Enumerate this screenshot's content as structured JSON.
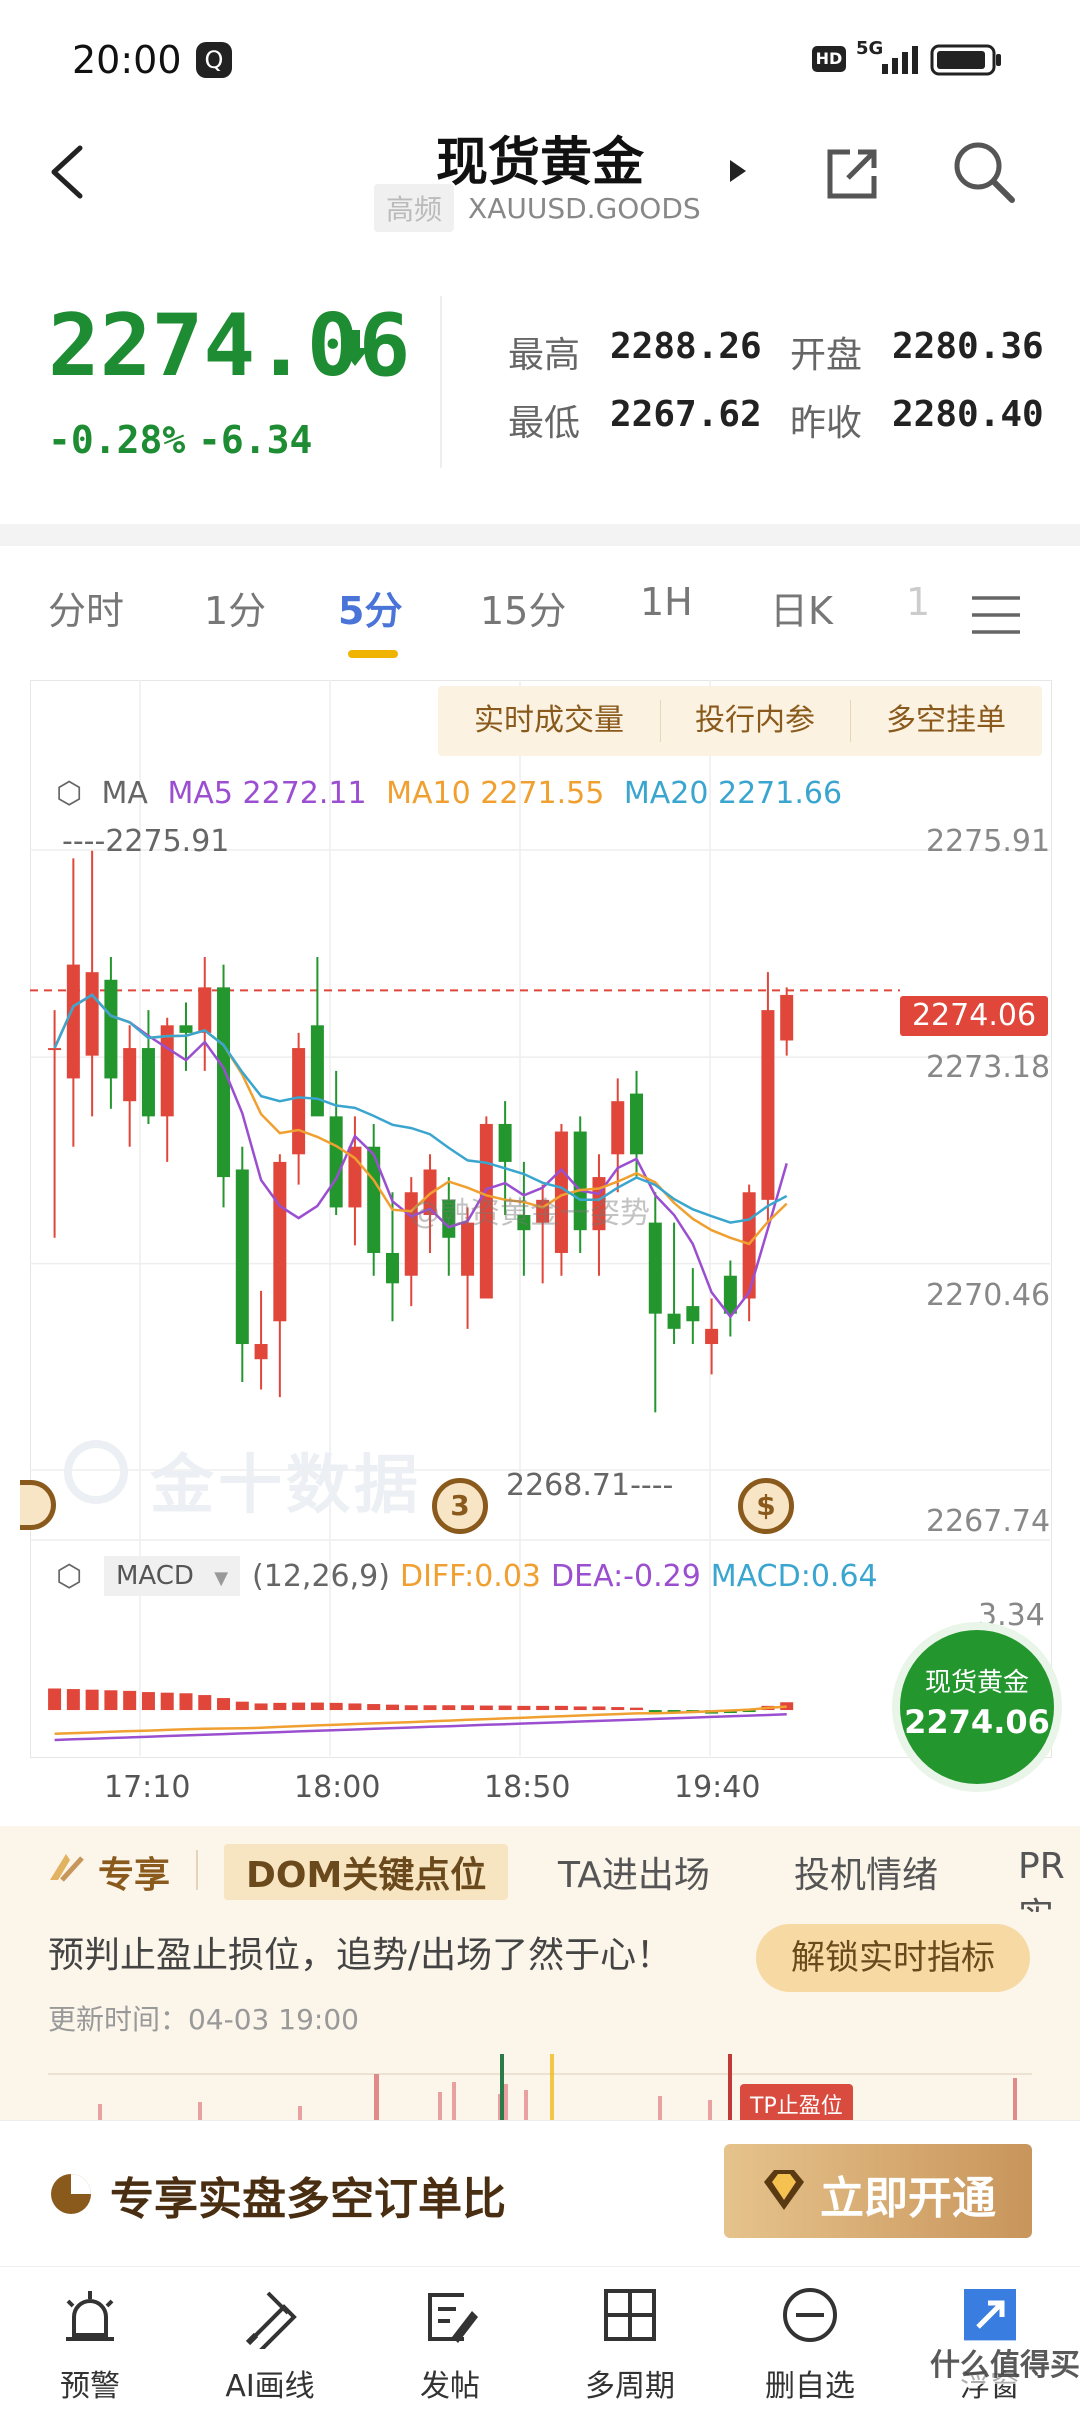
{
  "status_bar": {
    "time": "20:00",
    "network": "5G"
  },
  "header": {
    "title": "现货黄金",
    "tag": "高频",
    "symbol": "XAUUSD.GOODS"
  },
  "quote": {
    "price": "2274.06",
    "change_pct": "-0.28%",
    "change_abs": "-6.34",
    "high_label": "最高",
    "high": "2288.26",
    "open_label": "开盘",
    "open": "2280.36",
    "low_label": "最低",
    "low": "2267.62",
    "prev_close_label": "昨收",
    "prev_close": "2280.40"
  },
  "period_tabs": [
    "分时",
    "1分",
    "5分",
    "15分",
    "1H",
    "日K",
    "1"
  ],
  "active_tab": "5分",
  "chart_tools": [
    "实时成交量",
    "投行内参",
    "多空挂单"
  ],
  "ma": {
    "label": "MA",
    "ma5": "MA5 2272.11",
    "ma10": "MA10 2271.55",
    "ma20": "MA20 2271.66",
    "colors": {
      "ma5": "#9b4fd0",
      "ma10": "#f0a030",
      "ma20": "#3aa6d0"
    }
  },
  "price_axis": {
    "top": "2275.91",
    "last": "2274.06",
    "mid1": "2273.18",
    "mid2": "2270.46",
    "bottom": "2267.74"
  },
  "high_mark": "2275.91",
  "low_mark": "2268.71",
  "watermark": "金十数据",
  "weibo_watermark": "@融资黄金一姿势",
  "event_badges": [
    "3",
    "$"
  ],
  "macd": {
    "label": "MACD",
    "params": "(12,26,9)",
    "diff": "DIFF:0.03",
    "dea": "DEA:-0.29",
    "macd": "MACD:0.64",
    "axis_top": "3.34"
  },
  "x_axis": [
    "17:10",
    "18:00",
    "18:50",
    "19:40"
  ],
  "float_quote": {
    "name": "现货黄金",
    "price": "2274.06"
  },
  "feature_tabs": {
    "exclusive": "专享",
    "items": [
      "DOM关键点位",
      "TA进出场",
      "投机情绪",
      "PR实"
    ]
  },
  "promo": {
    "text": "预判止盈止损位，追势/出场了然于心！",
    "button": "解锁实时指标",
    "update_time": "更新时间：04-03 19:00",
    "mini_tag": "TP止盈位"
  },
  "cta": {
    "text": "专享实盘多空订单比",
    "button": "立即开通"
  },
  "bottom_nav": [
    "预警",
    "AI画线",
    "发帖",
    "多周期",
    "删自选",
    "浮窗"
  ],
  "corner_watermark": "什么值得买",
  "chart_data": {
    "type": "candlestick",
    "candles": [
      {
        "o": 2273.3,
        "h": 2273.8,
        "l": 2270.8,
        "c": 2273.3,
        "dir": "up"
      },
      {
        "o": 2272.9,
        "h": 2275.8,
        "l": 2272.0,
        "c": 2274.4,
        "dir": "up"
      },
      {
        "o": 2273.2,
        "h": 2275.9,
        "l": 2272.4,
        "c": 2274.3,
        "dir": "up"
      },
      {
        "o": 2274.2,
        "h": 2274.5,
        "l": 2272.5,
        "c": 2272.9,
        "dir": "down"
      },
      {
        "o": 2272.6,
        "h": 2273.6,
        "l": 2272.0,
        "c": 2273.3,
        "dir": "up"
      },
      {
        "o": 2273.3,
        "h": 2273.8,
        "l": 2272.3,
        "c": 2272.4,
        "dir": "down"
      },
      {
        "o": 2272.4,
        "h": 2273.7,
        "l": 2271.8,
        "c": 2273.6,
        "dir": "up"
      },
      {
        "o": 2273.6,
        "h": 2273.9,
        "l": 2273.0,
        "c": 2273.5,
        "dir": "down"
      },
      {
        "o": 2273.5,
        "h": 2274.5,
        "l": 2273.0,
        "c": 2274.1,
        "dir": "up"
      },
      {
        "o": 2274.1,
        "h": 2274.4,
        "l": 2271.2,
        "c": 2271.6,
        "dir": "down"
      },
      {
        "o": 2271.7,
        "h": 2272.0,
        "l": 2268.9,
        "c": 2269.4,
        "dir": "down"
      },
      {
        "o": 2269.4,
        "h": 2270.1,
        "l": 2268.8,
        "c": 2269.2,
        "dir": "up"
      },
      {
        "o": 2269.7,
        "h": 2271.9,
        "l": 2268.7,
        "c": 2271.8,
        "dir": "up"
      },
      {
        "o": 2271.9,
        "h": 2273.5,
        "l": 2271.5,
        "c": 2273.3,
        "dir": "up"
      },
      {
        "o": 2273.6,
        "h": 2274.5,
        "l": 2272.5,
        "c": 2272.4,
        "dir": "down"
      },
      {
        "o": 2272.4,
        "h": 2273.0,
        "l": 2271.1,
        "c": 2271.2,
        "dir": "down"
      },
      {
        "o": 2271.2,
        "h": 2272.4,
        "l": 2270.7,
        "c": 2272.0,
        "dir": "up"
      },
      {
        "o": 2272.0,
        "h": 2272.3,
        "l": 2270.3,
        "c": 2270.6,
        "dir": "down"
      },
      {
        "o": 2270.6,
        "h": 2271.4,
        "l": 2269.7,
        "c": 2270.2,
        "dir": "down"
      },
      {
        "o": 2270.3,
        "h": 2271.6,
        "l": 2269.9,
        "c": 2271.4,
        "dir": "up"
      },
      {
        "o": 2271.1,
        "h": 2271.9,
        "l": 2270.6,
        "c": 2271.7,
        "dir": "up"
      },
      {
        "o": 2271.3,
        "h": 2271.6,
        "l": 2270.3,
        "c": 2270.8,
        "dir": "down"
      },
      {
        "o": 2270.3,
        "h": 2271.2,
        "l": 2269.6,
        "c": 2271.0,
        "dir": "up"
      },
      {
        "o": 2270.0,
        "h": 2272.4,
        "l": 2270.0,
        "c": 2272.3,
        "dir": "up"
      },
      {
        "o": 2272.3,
        "h": 2272.6,
        "l": 2271.1,
        "c": 2271.8,
        "dir": "down"
      },
      {
        "o": 2271.1,
        "h": 2271.8,
        "l": 2270.3,
        "c": 2270.9,
        "dir": "down"
      },
      {
        "o": 2271.0,
        "h": 2271.5,
        "l": 2270.2,
        "c": 2271.3,
        "dir": "up"
      },
      {
        "o": 2270.6,
        "h": 2272.3,
        "l": 2270.3,
        "c": 2272.2,
        "dir": "up"
      },
      {
        "o": 2272.2,
        "h": 2272.4,
        "l": 2270.6,
        "c": 2270.9,
        "dir": "down"
      },
      {
        "o": 2270.9,
        "h": 2271.9,
        "l": 2270.3,
        "c": 2271.6,
        "dir": "up"
      },
      {
        "o": 2271.9,
        "h": 2272.9,
        "l": 2271.4,
        "c": 2272.6,
        "dir": "up"
      },
      {
        "o": 2272.7,
        "h": 2273.0,
        "l": 2271.6,
        "c": 2271.9,
        "dir": "down"
      },
      {
        "o": 2271.0,
        "h": 2271.4,
        "l": 2268.5,
        "c": 2269.8,
        "dir": "down"
      },
      {
        "o": 2269.8,
        "h": 2271.0,
        "l": 2269.4,
        "c": 2269.6,
        "dir": "down"
      },
      {
        "o": 2269.9,
        "h": 2270.4,
        "l": 2269.4,
        "c": 2269.7,
        "dir": "down"
      },
      {
        "o": 2269.6,
        "h": 2270.0,
        "l": 2269.0,
        "c": 2269.4,
        "dir": "up"
      },
      {
        "o": 2269.8,
        "h": 2270.5,
        "l": 2269.5,
        "c": 2270.3,
        "dir": "down"
      },
      {
        "o": 2270.0,
        "h": 2271.5,
        "l": 2269.7,
        "c": 2271.4,
        "dir": "up"
      },
      {
        "o": 2271.3,
        "h": 2274.3,
        "l": 2271.0,
        "c": 2273.8,
        "dir": "up"
      },
      {
        "o": 2273.4,
        "h": 2274.1,
        "l": 2273.2,
        "c": 2274.0,
        "dir": "up"
      }
    ],
    "last_price": 2274.06,
    "y_range": [
      2267.74,
      2275.91
    ],
    "x_ticks": [
      "17:10",
      "18:00",
      "18:50",
      "19:40"
    ],
    "macd_hist": [
      0.72,
      0.7,
      0.68,
      0.66,
      0.64,
      0.6,
      0.58,
      0.56,
      0.5,
      0.4,
      0.28,
      0.22,
      0.24,
      0.25,
      0.25,
      0.24,
      0.22,
      0.2,
      0.18,
      0.16,
      0.16,
      0.16,
      0.16,
      0.15,
      0.15,
      0.14,
      0.14,
      0.14,
      0.12,
      0.12,
      0.1,
      0.08,
      -0.04,
      -0.08,
      -0.1,
      -0.12,
      -0.1,
      -0.06,
      0.14,
      0.26
    ],
    "macd_range": [
      -1.0,
      3.34
    ]
  }
}
